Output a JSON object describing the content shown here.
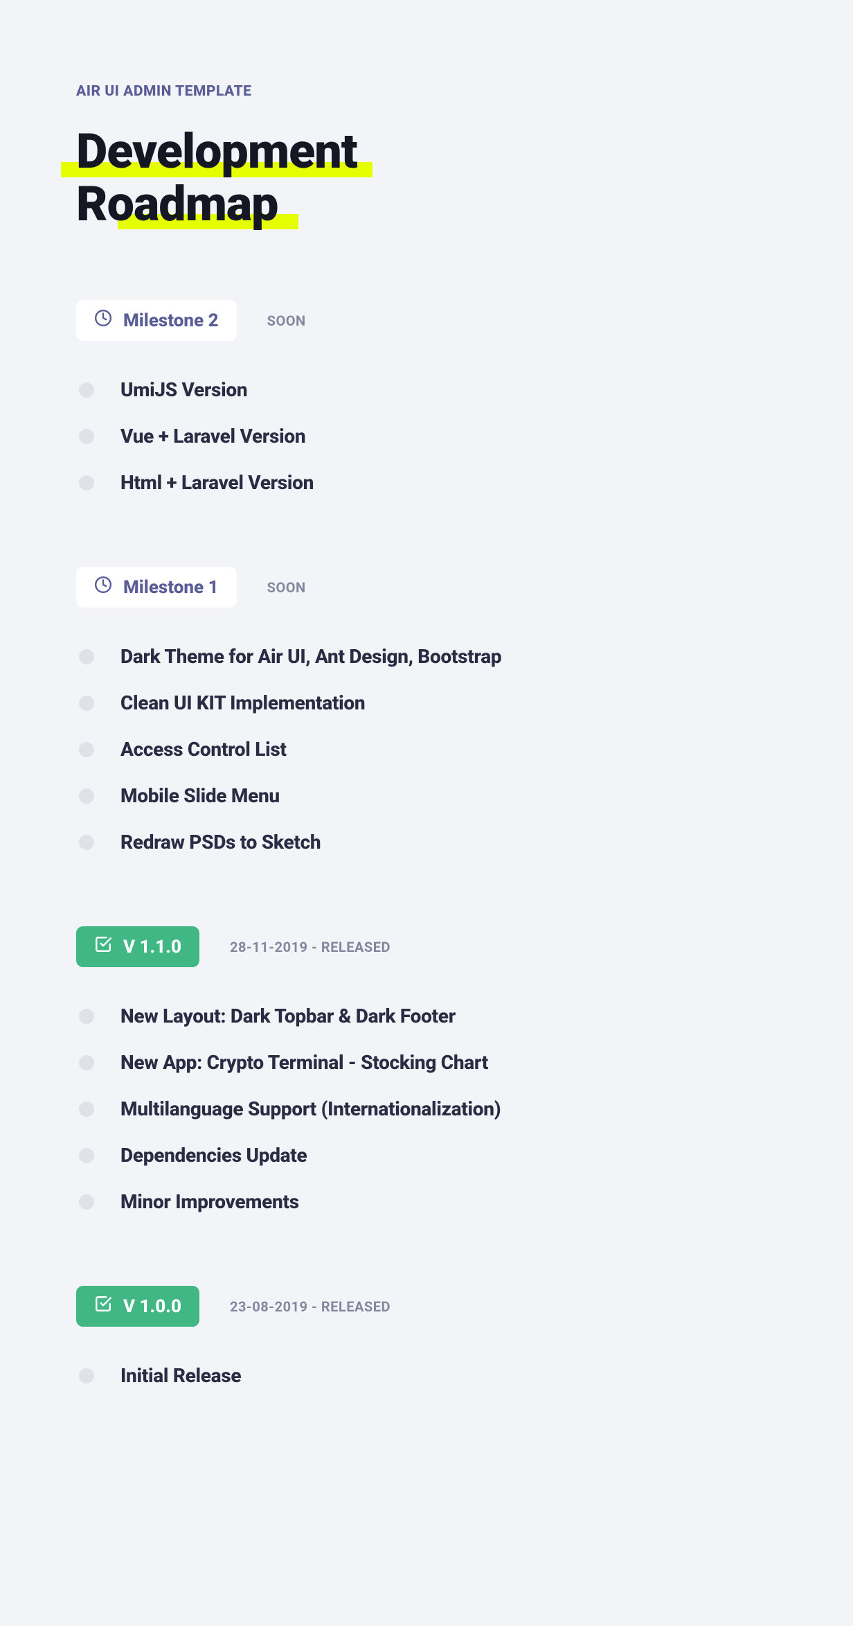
{
  "eyebrow": "AIR UI ADMIN TEMPLATE",
  "title": {
    "line1": "Development",
    "line2": "Roadmap"
  },
  "sections": [
    {
      "badge_kind": "milestone",
      "badge_label": "Milestone 2",
      "meta": "SOON",
      "items": [
        "UmiJS Version",
        "Vue + Laravel Version",
        "Html + Laravel Version"
      ]
    },
    {
      "badge_kind": "milestone",
      "badge_label": "Milestone 1",
      "meta": "SOON",
      "items": [
        "Dark Theme for Air UI, Ant Design, Bootstrap",
        "Clean UI KIT Implementation",
        "Access Control List",
        "Mobile Slide Menu",
        "Redraw PSDs to Sketch"
      ]
    },
    {
      "badge_kind": "version",
      "badge_label": "V 1.1.0",
      "meta": "28-11-2019 - RELEASED",
      "items": [
        "New Layout: Dark Topbar & Dark Footer",
        "New App: Crypto Terminal - Stocking Chart",
        "Multilanguage Support (Internationalization)",
        "Dependencies Update",
        "Minor Improvements"
      ]
    },
    {
      "badge_kind": "version",
      "badge_label": "V 1.0.0",
      "meta": "23-08-2019 - RELEASED",
      "items": [
        "Initial Release"
      ]
    }
  ]
}
